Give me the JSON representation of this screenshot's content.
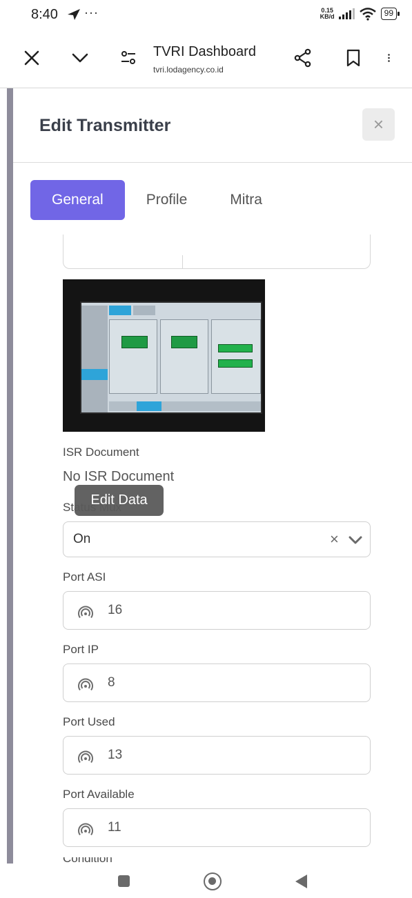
{
  "status_bar": {
    "time": "8:40",
    "dots": "···",
    "net_speed_value": "0.15",
    "net_speed_unit": "KB/d",
    "battery": "99"
  },
  "browser": {
    "title": "TVRI Dashboard",
    "url": "tvri.lodagency.co.id"
  },
  "modal": {
    "title": "Edit Transmitter",
    "close_label": "×"
  },
  "tabs": [
    {
      "label": "General",
      "active": true
    },
    {
      "label": "Profile",
      "active": false
    },
    {
      "label": "Mitra",
      "active": false
    }
  ],
  "isr": {
    "label": "ISR Document",
    "value": "No ISR Document"
  },
  "tooltip": "Edit Data",
  "status_mux": {
    "label": "Status Mux",
    "value": "On",
    "clear": "×"
  },
  "fields": [
    {
      "label": "Port ASI",
      "value": "16"
    },
    {
      "label": "Port IP",
      "value": "8"
    },
    {
      "label": "Port Used",
      "value": "13"
    },
    {
      "label": "Port Available",
      "value": "11"
    }
  ],
  "next_label": "Condition",
  "colors": {
    "accent": "#7166e6",
    "sidebar": "#8e8c9b"
  }
}
